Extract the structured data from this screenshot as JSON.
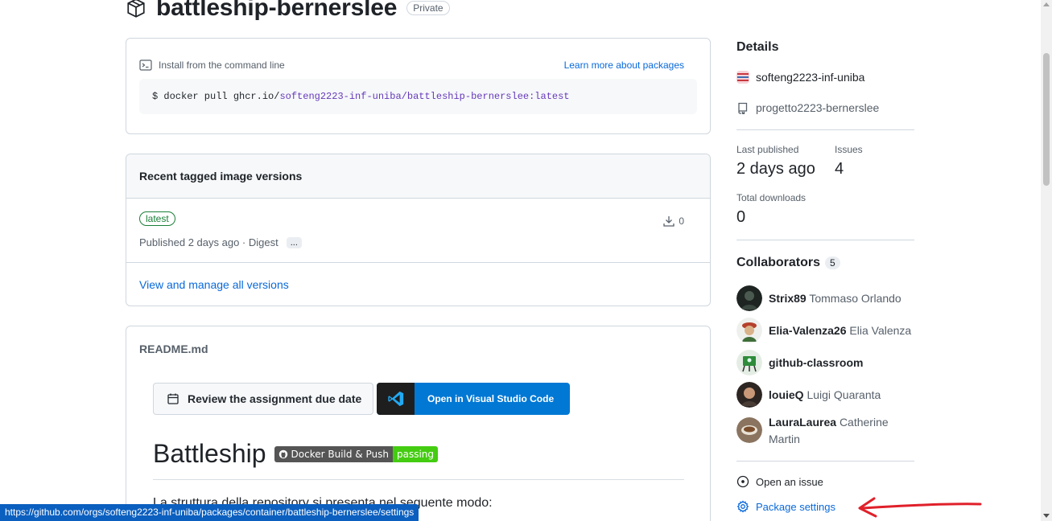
{
  "package": {
    "name": "battleship-bernerslee",
    "visibility": "Private"
  },
  "install": {
    "heading": "Install from the command line",
    "learn_more": "Learn more about packages",
    "cmd_prefix": "$ docker pull ghcr.io/",
    "cmd_org": "softeng2223-inf-uniba",
    "cmd_slash": "/",
    "cmd_repo": "battleship-bernerslee:latest"
  },
  "versions": {
    "heading": "Recent tagged image versions",
    "items": [
      {
        "tag": "latest",
        "published": "Published 2 days ago · Digest",
        "more": "...",
        "downloads": "0"
      }
    ],
    "manage_link": "View and manage all versions"
  },
  "readme": {
    "filename": "README.md",
    "due_button": "Review the assignment due date",
    "vscode_button": "Open in Visual Studio Code",
    "title": "Battleship",
    "badge_left": "Docker Build & Push",
    "badge_right": "passing",
    "first_line": "La struttura della repository si presenta nel seguente modo:"
  },
  "sidebar": {
    "details_heading": "Details",
    "org": "softeng2223-inf-uniba",
    "repo": "progetto2223-bernerslee",
    "last_published_label": "Last published",
    "last_published_value": "2 days ago",
    "issues_label": "Issues",
    "issues_value": "4",
    "downloads_label": "Total downloads",
    "downloads_value": "0",
    "collaborators_heading": "Collaborators",
    "collaborators_count": "5",
    "collaborators": [
      {
        "login": "Strix89",
        "name": "Tommaso Orlando"
      },
      {
        "login": "Elia-Valenza26",
        "name": "Elia Valenza"
      },
      {
        "login": "github-classroom",
        "name": ""
      },
      {
        "login": "louieQ",
        "name": "Luigi Quaranta"
      },
      {
        "login": "LauraLaurea",
        "name": "Catherine Martin"
      }
    ],
    "open_issue": "Open an issue",
    "package_settings": "Package settings"
  },
  "status_bar": {
    "url": "https://github.com/orgs/softeng2223-inf-uniba/packages/container/battleship-bernerslee/settings"
  },
  "colors": {
    "link": "#0969da",
    "tag_green": "#1a7f37",
    "vscode_blue": "#0078d4",
    "annotation_arrow": "#e0202a"
  }
}
